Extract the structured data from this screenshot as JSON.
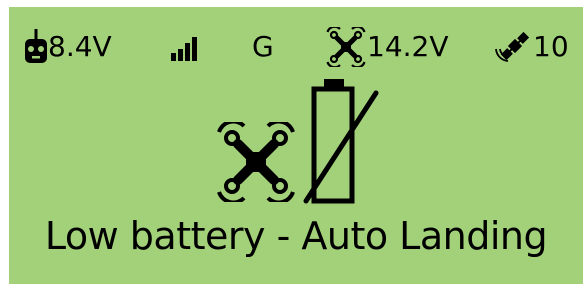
{
  "status_bar": {
    "radio_icon": "rc-controller-icon",
    "radio_voltage": "8.4V",
    "signal_icon": "signal-strength-icon",
    "mode": "G",
    "drone_icon": "quadcopter-icon",
    "drone_voltage": "14.2V",
    "gps_icon": "satellite-icon",
    "satellite_count": "10"
  },
  "alert": {
    "drone_icon": "quadcopter-icon",
    "battery_icon": "battery-empty-slashed-icon",
    "message": "Low battery - Auto Landing"
  },
  "colors": {
    "screen_background": "#a3d17a",
    "foreground": "#000000"
  }
}
